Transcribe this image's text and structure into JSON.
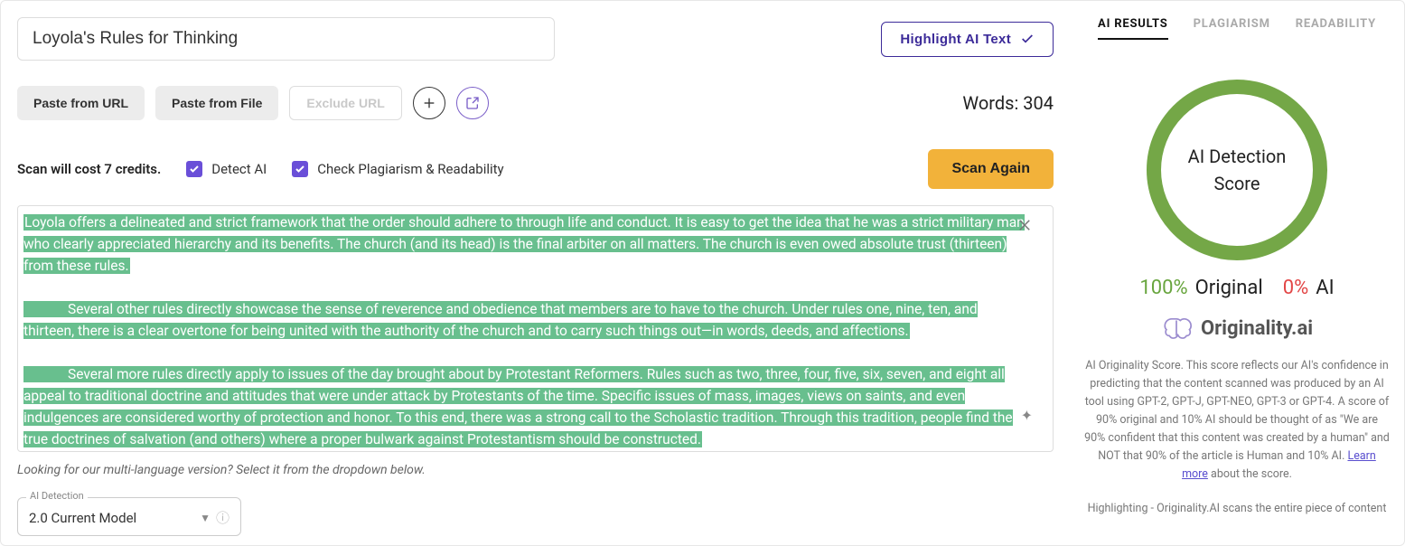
{
  "title": "Loyola's Rules for Thinking",
  "highlight_btn": "Highlight AI Text",
  "toolbar": {
    "paste_url": "Paste from URL",
    "paste_file": "Paste from File",
    "exclude_url": "Exclude URL"
  },
  "words_label": "Words: 304",
  "options": {
    "cost": "Scan will cost 7 credits.",
    "detect_ai": "Detect AI",
    "check_plag": "Check Plagiarism & Readability"
  },
  "scan_btn": "Scan Again",
  "content": {
    "p1": "Loyola offers a delineated and strict framework that the order should adhere to through life and conduct. It is easy to get the idea that he was a strict military man who clearly appreciated hierarchy and its benefits. The church (and its head) is the final arbiter on all matters. The church is even owed absolute trust (thirteen) from these rules.",
    "p2": "Several other rules directly showcase the sense of reverence and obedience that members are to have to the church. Under rules one, nine, ten, and thirteen, there is a clear overtone for being united with the authority of the church and to carry such things out—in words, deeds, and affections.",
    "p3": "Several more rules directly apply to issues of the day brought about by Protestant Reformers. Rules such as two, three, four, five, six, seven, and eight all appeal to traditional doctrine and attitudes that were under attack by Protestants of the time. Specific issues of mass, images, views on saints, and even indulgences are considered worthy of protection and honor. To this end, there was a strong call to the Scholastic tradition. Through this tradition, people find the true doctrines of salvation (and others) where a proper bulwark against Protestantism should be constructed."
  },
  "hint": "Looking for our multi-language version? Select it from the dropdown below.",
  "model": {
    "legend": "AI Detection",
    "value": "2.0 Current Model"
  },
  "tabs": {
    "results": "AI RESULTS",
    "plagiarism": "PLAGIARISM",
    "readability": "READABILITY"
  },
  "score": {
    "circle_line1": "AI Detection",
    "circle_line2": "Score",
    "original_pct": "100%",
    "original_label": "Original",
    "ai_pct": "0%",
    "ai_label": "AI"
  },
  "brand": "Originality.ai",
  "desc": {
    "text1": "AI Originality Score. This score reflects our AI's confidence in predicting that the content scanned was produced by an AI tool using GPT-2, GPT-J, GPT-NEO, GPT-3 or GPT-4. A score of 90% original and 10% AI should be thought of as \"We are 90% confident that this content was created by a human\" and NOT that 90% of the article is Human and 10% AI. ",
    "learn_more": "Learn more",
    "text2": " about the score.",
    "highlight": "Highlighting - Originality.AI scans the entire piece of content"
  }
}
